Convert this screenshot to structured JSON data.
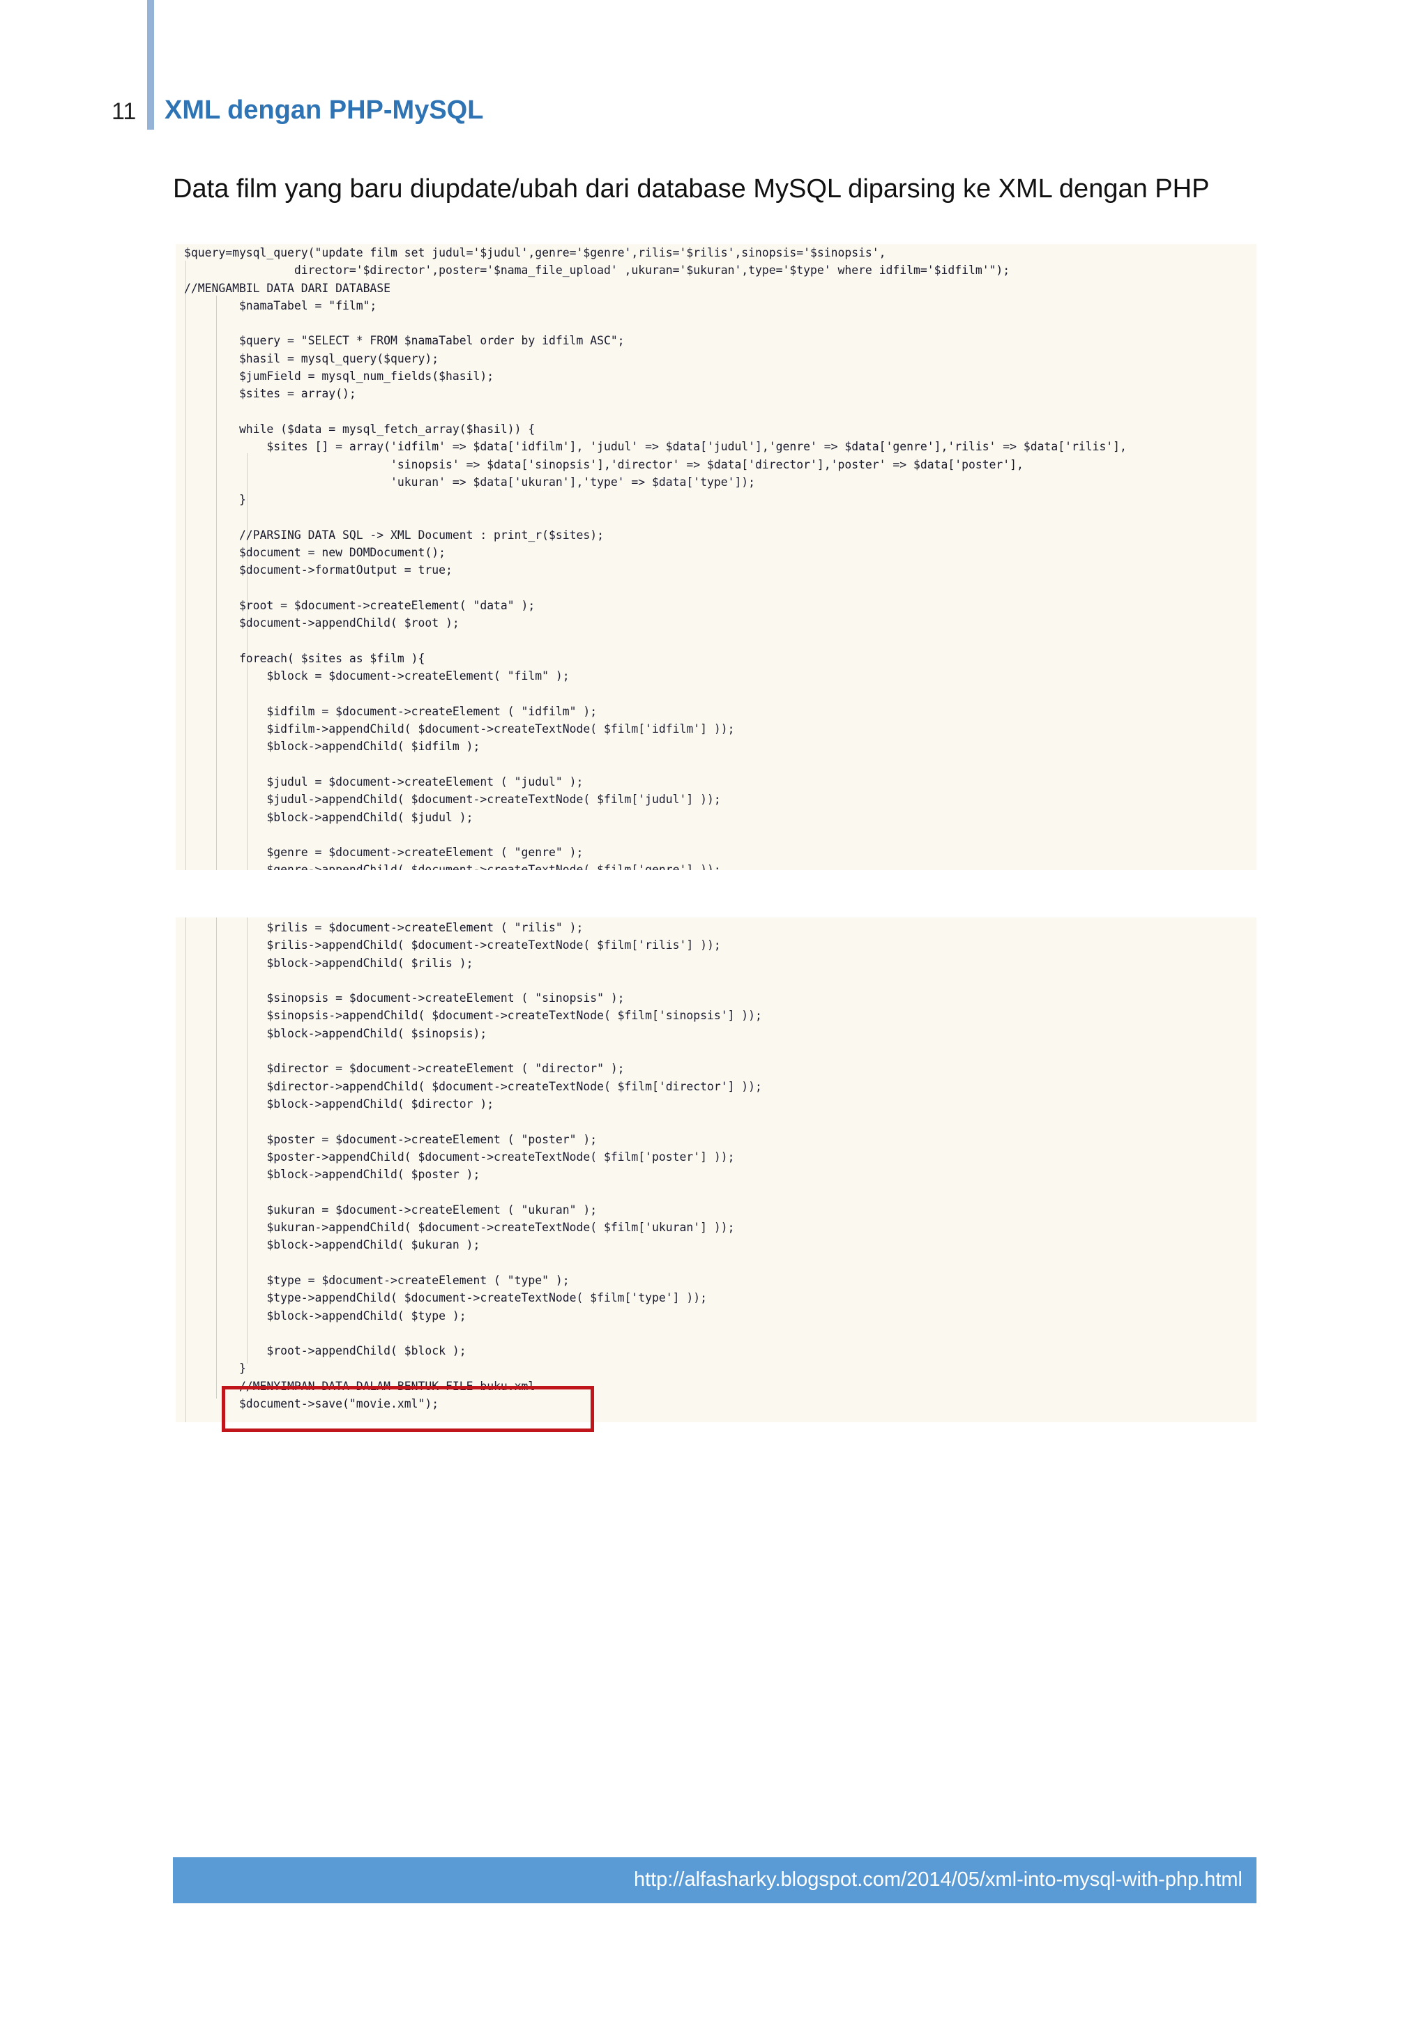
{
  "header": {
    "page_number": "11",
    "title": "XML dengan PHP-MySQL"
  },
  "caption": "Data film yang baru diupdate/ubah dari database MySQL diparsing ke XML dengan PHP",
  "code": {
    "block1": "$query=mysql_query(\"update film set judul='$judul',genre='$genre',rilis='$rilis',sinopsis='$sinopsis',\n                director='$director',poster='$nama_file_upload' ,ukuran='$ukuran',type='$type' where idfilm='$idfilm'\");\n//MENGAMBIL DATA DARI DATABASE\n        $namaTabel = \"film\";\n\n        $query = \"SELECT * FROM $namaTabel order by idfilm ASC\";\n        $hasil = mysql_query($query);\n        $jumField = mysql_num_fields($hasil);\n        $sites = array();\n\n        while ($data = mysql_fetch_array($hasil)) {\n            $sites [] = array('idfilm' => $data['idfilm'], 'judul' => $data['judul'],'genre' => $data['genre'],'rilis' => $data['rilis'],\n                              'sinopsis' => $data['sinopsis'],'director' => $data['director'],'poster' => $data['poster'],\n                              'ukuran' => $data['ukuran'],'type' => $data['type']);\n        }\n\n        //PARSING DATA SQL -> XML Document : print_r($sites);\n        $document = new DOMDocument();\n        $document->formatOutput = true;\n\n        $root = $document->createElement( \"data\" );\n        $document->appendChild( $root );\n\n        foreach( $sites as $film ){\n            $block = $document->createElement( \"film\" );\n\n            $idfilm = $document->createElement ( \"idfilm\" );\n            $idfilm->appendChild( $document->createTextNode( $film['idfilm'] ));\n            $block->appendChild( $idfilm );\n\n            $judul = $document->createElement ( \"judul\" );\n            $judul->appendChild( $document->createTextNode( $film['judul'] ));\n            $block->appendChild( $judul );\n\n            $genre = $document->createElement ( \"genre\" );\n            $genre->appendChild( $document->createTextNode( $film['genre'] ));\n            $block->appendChild( $genre );",
    "block2": "            $rilis = $document->createElement ( \"rilis\" );\n            $rilis->appendChild( $document->createTextNode( $film['rilis'] ));\n            $block->appendChild( $rilis );\n\n            $sinopsis = $document->createElement ( \"sinopsis\" );\n            $sinopsis->appendChild( $document->createTextNode( $film['sinopsis'] ));\n            $block->appendChild( $sinopsis);\n\n            $director = $document->createElement ( \"director\" );\n            $director->appendChild( $document->createTextNode( $film['director'] ));\n            $block->appendChild( $director );\n\n            $poster = $document->createElement ( \"poster\" );\n            $poster->appendChild( $document->createTextNode( $film['poster'] ));\n            $block->appendChild( $poster );\n\n            $ukuran = $document->createElement ( \"ukuran\" );\n            $ukuran->appendChild( $document->createTextNode( $film['ukuran'] ));\n            $block->appendChild( $ukuran );\n\n            $type = $document->createElement ( \"type\" );\n            $type->appendChild( $document->createTextNode( $film['type'] ));\n            $block->appendChild( $type );\n\n            $root->appendChild( $block );\n        }\n        //MENYIMPAN DATA DALAM BENTUK FILE buku.xml\n        $document->save(\"movie.xml\");"
  },
  "footer": {
    "url": "http://alfasharky.blogspot.com/2014/05/xml-into-mysql-with-php.html"
  },
  "colors": {
    "title_blue": "#2e74b5",
    "footer_blue": "#5b9bd5",
    "header_bar": "#95b3d7",
    "highlight_red": "#c0151b",
    "code_background": "#fbf9ef"
  }
}
